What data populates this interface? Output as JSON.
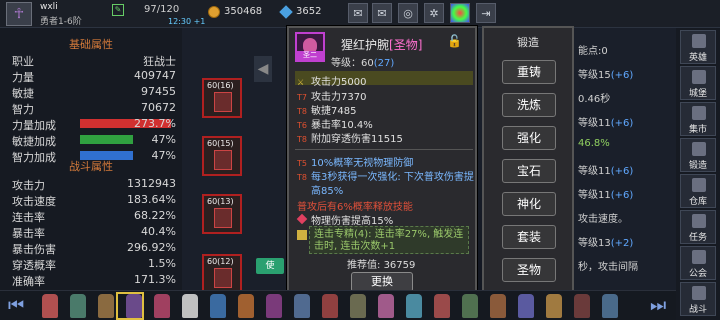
{
  "player": {
    "name": "wxli",
    "level_label": "勇者1-6阶",
    "edit_icon": "edit-icon"
  },
  "resources": {
    "energy": "97/120",
    "energy_sub": "12:30 +1",
    "gold": "350468",
    "diamonds": "3652"
  },
  "toolbar_icons": [
    "mail-icon",
    "mail-icon",
    "gamepad-icon",
    "gear-icon",
    "color-wheel-icon",
    "exit-icon"
  ],
  "stats": {
    "basic_header": "基础属性",
    "basic": [
      {
        "k": "职业",
        "v": "狂战士"
      },
      {
        "k": "力量",
        "v": "409747"
      },
      {
        "k": "敏捷",
        "v": "97455"
      },
      {
        "k": "智力",
        "v": "70672"
      },
      {
        "k": "力量加成",
        "v": "273.7%",
        "bar_color": "#d03030",
        "fill": 0.95
      },
      {
        "k": "敏捷加成",
        "v": "47%",
        "bar_color": "#30a040",
        "fill": 0.55
      },
      {
        "k": "智力加成",
        "v": "47%",
        "bar_color": "#3070d0",
        "fill": 0.55
      }
    ],
    "combat_header": "战斗属性",
    "combat": [
      {
        "k": "攻击力",
        "v": "1312943"
      },
      {
        "k": "攻击速度",
        "v": "183.64%"
      },
      {
        "k": "连击率",
        "v": "68.22%"
      },
      {
        "k": "暴击率",
        "v": "40.4%"
      },
      {
        "k": "暴击伤害",
        "v": "296.92%"
      },
      {
        "k": "穿透概率",
        "v": "1.5%"
      },
      {
        "k": "准确率",
        "v": "171.3%"
      }
    ]
  },
  "equip_slots": [
    "60(16)",
    "60(15)",
    "60(13)",
    "60(12)"
  ],
  "item": {
    "name": "猩红护腕",
    "quality": "[圣物]",
    "quality_badge": "圣二",
    "req_label": "等级：60",
    "req_sub": "(27)",
    "lock_icon": "unlock-icon",
    "main_stat": "攻击力5000",
    "attrs": [
      {
        "tier": "T7",
        "text": "攻击力7370"
      },
      {
        "tier": "T8",
        "text": "敏捷7485"
      },
      {
        "tier": "T6",
        "text": "暴击率10.4%"
      },
      {
        "tier": "T8",
        "text": "附加穿透伤害11515"
      }
    ],
    "special": [
      {
        "tier": "T5",
        "text": "10%概率无视物理防御"
      },
      {
        "tier": "T8",
        "text": "每3秒获得一次强化: 下次普攻伤害提"
      },
      {
        "tier": "",
        "text": "高85%"
      }
    ],
    "red_line": "普攻后有6%概率释放技能",
    "gem_line": "物理伤害提高15%",
    "set_line": "连击专精(4): 连击率27%, 触发连击时, 连击次数+1",
    "score_label": "推荐值:",
    "score_value": "36759",
    "replace_label": "更换"
  },
  "forge": {
    "title": "锻造",
    "buttons": [
      "重铸",
      "洗炼",
      "强化",
      "宝石",
      "神化",
      "套装",
      "圣物"
    ]
  },
  "right_info": [
    {
      "pre": "能点:",
      "val": "0",
      "cls": ""
    },
    {
      "pre": "等级15",
      "val": "(+6)",
      "cls": "s"
    },
    {
      "pre": "",
      "val": "0.46秒",
      "cls": ""
    },
    {
      "pre": "等级11",
      "val": "(+6)",
      "cls": "s"
    },
    {
      "pre": "",
      "val": "46.8%",
      "cls": "g"
    },
    {
      "pre": "等级11",
      "val": "(+6)",
      "cls": "s"
    },
    {
      "pre": "等级11",
      "val": "(+6)",
      "cls": "s"
    },
    {
      "pre": "",
      "val": "攻击速度。",
      "cls": ""
    },
    {
      "pre": "等级13",
      "val": "(+2)",
      "cls": "s"
    },
    {
      "pre": "",
      "val": "秒，攻击间隔",
      "cls": ""
    }
  ],
  "right_nav": [
    "英雄",
    "城堡",
    "集市",
    "锻造",
    "仓库",
    "任务",
    "公会",
    "战斗"
  ],
  "bottom_pill": "使"
}
